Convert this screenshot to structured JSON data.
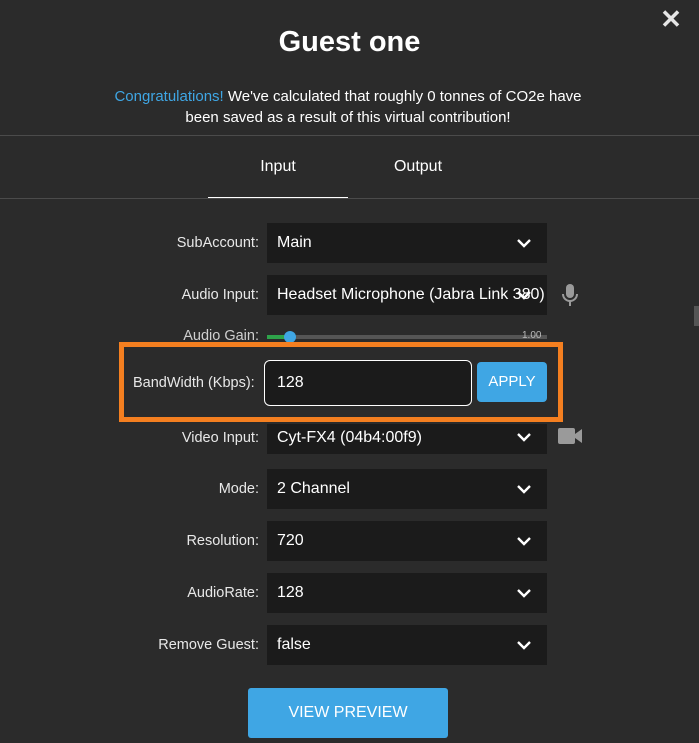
{
  "header": {
    "title": "Guest one",
    "congrats_accent": "Congratulations!",
    "congrats_line1": " We've calculated that roughly 0 tonnes of CO2e have",
    "congrats_line2": "been saved as a result of this virtual contribution!"
  },
  "tabs": [
    {
      "label": "Input",
      "active": true
    },
    {
      "label": "Output",
      "active": false
    }
  ],
  "form": {
    "subaccount": {
      "label": "SubAccount:",
      "value": "Main"
    },
    "audio_input": {
      "label": "Audio Input:",
      "value": "Headset Microphone (Jabra Link 380)"
    },
    "audio_gain": {
      "label": "Audio Gain:",
      "value": "1.00"
    },
    "bandwidth": {
      "label": "BandWidth (Kbps):",
      "value": "128",
      "apply_label": "APPLY"
    },
    "video_input": {
      "label": "Video Input:",
      "value": "Cyt-FX4 (04b4:00f9)"
    },
    "mode": {
      "label": "Mode:",
      "value": "2 Channel"
    },
    "resolution": {
      "label": "Resolution:",
      "value": "720"
    },
    "audiorate": {
      "label": "AudioRate:",
      "value": "128"
    },
    "remove_guest": {
      "label": "Remove Guest:",
      "value": "false"
    }
  },
  "footer": {
    "preview_label": "VIEW PREVIEW"
  },
  "icons": {
    "close": "close-icon",
    "chevron": "chevron-down-icon",
    "mic": "microphone-icon",
    "camera": "video-camera-icon"
  },
  "colors": {
    "accent": "#3fa6e4",
    "highlight": "#f47f20",
    "background": "#2b2b2b",
    "field": "#1b1b1b"
  }
}
